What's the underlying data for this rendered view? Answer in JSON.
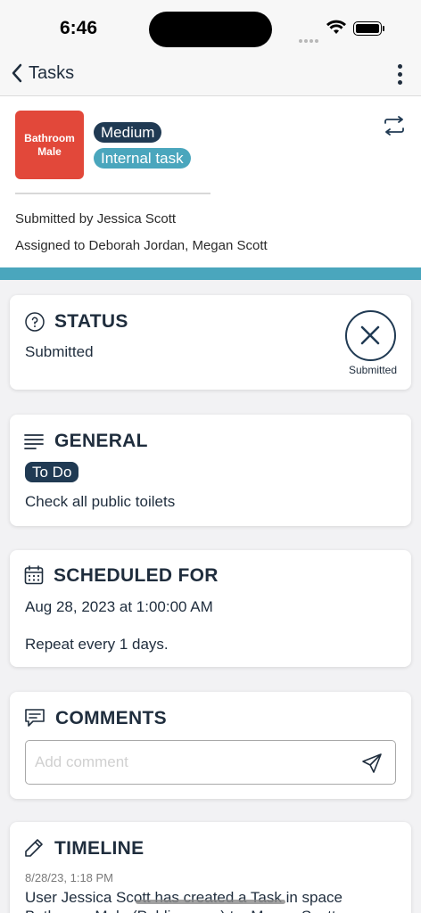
{
  "status_bar": {
    "time": "6:46"
  },
  "nav": {
    "back_label": "Tasks"
  },
  "header": {
    "space_name": "Bathroom Male",
    "priority": "Medium",
    "task_type": "Internal task",
    "submitted_by": "Submitted by Jessica Scott",
    "assigned_to": "Assigned to Deborah Jordan, Megan Scott",
    "space_color": "#e2483a",
    "accent_color": "#4aa6bd"
  },
  "status_card": {
    "title": "STATUS",
    "value": "Submitted",
    "badge_caption": "Submitted"
  },
  "general_card": {
    "title": "GENERAL",
    "state": "To Do",
    "description": "Check all public toilets"
  },
  "scheduled_card": {
    "title": "SCHEDULED FOR",
    "datetime": "Aug 28, 2023 at 1:00:00 AM",
    "repeat": "Repeat every 1 days."
  },
  "comments_card": {
    "title": "COMMENTS",
    "placeholder": "Add comment"
  },
  "timeline_card": {
    "title": "TIMELINE",
    "entries": [
      {
        "date": "8/28/23, 1:18 PM",
        "text": "User Jessica Scott has created a Task in space Bathroom Male (Public areas) to: Megan Scott"
      }
    ]
  },
  "icons": [
    "chevron-left-icon",
    "more-vertical-icon",
    "swap-icon",
    "question-circle-icon",
    "close-circle-icon",
    "lines-icon",
    "calendar-icon",
    "comment-icon",
    "send-icon",
    "pencil-icon"
  ]
}
